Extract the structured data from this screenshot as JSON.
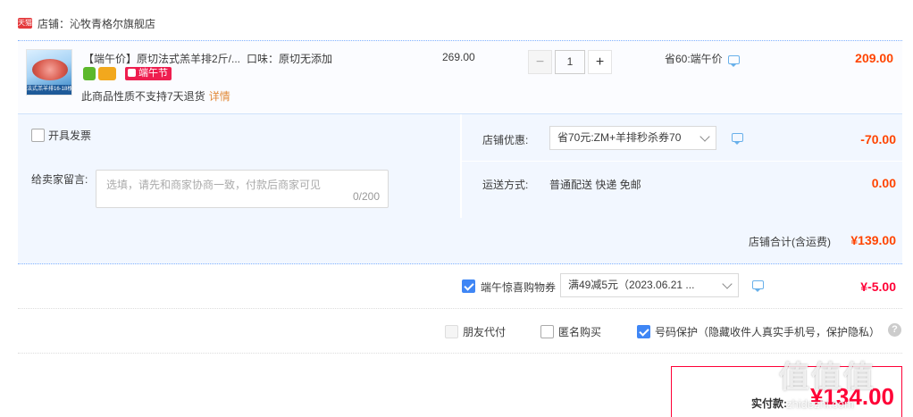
{
  "shop": {
    "badge": "天猫",
    "name": "店铺：沁牧青格尔旗舰店"
  },
  "product": {
    "thumb_caption": "法式羔羊排16-18根",
    "title": "【端午价】原切法式羔羊排2斤/...",
    "flavor": "口味：原切无添加",
    "festival_tag": "端午节",
    "return_note": "此商品性质不支持7天退货",
    "return_detail_link": "详情",
    "unit_price": "269.00",
    "quantity": "1",
    "minus": "−",
    "plus": "+",
    "save_note": "省60:端午价",
    "final_price": "209.00"
  },
  "options": {
    "invoice_label": "开具发票",
    "message_label": "给卖家留言:",
    "message_placeholder": "选填，请先和商家协商一致，付款后商家可见",
    "message_count": "0/200",
    "coupon_label": "店铺优惠:",
    "coupon_selected": "省70元:ZM+羊排秒杀券70",
    "coupon_amount": "-70.00",
    "shipping_label": "运送方式:",
    "shipping_value": "普通配送 快递 免邮",
    "shipping_amount": "0.00"
  },
  "subtotal": {
    "label": "店铺合计(含运费)",
    "amount": "¥139.00"
  },
  "gift_coupon": {
    "checked": true,
    "label": "端午惊喜购物券",
    "selected": "满49减5元（2023.06.21 ...",
    "amount": "¥-5.00"
  },
  "privacy": {
    "friend_pay": "朋友代付",
    "anonymous": "匿名购买",
    "number_protect": "号码保护（隐藏收件人真实手机号，保护隐私）",
    "help": "?"
  },
  "payment": {
    "label": "实付款:",
    "amount": "¥134.00"
  },
  "watermark": {
    "text": "值值值",
    "sub": "zhidezhi.com"
  },
  "colors": {
    "price_orange": "#ff4400",
    "price_red": "#ff0036",
    "accent_blue": "#3f86f5",
    "panel_bg": "#f2f7ff"
  }
}
